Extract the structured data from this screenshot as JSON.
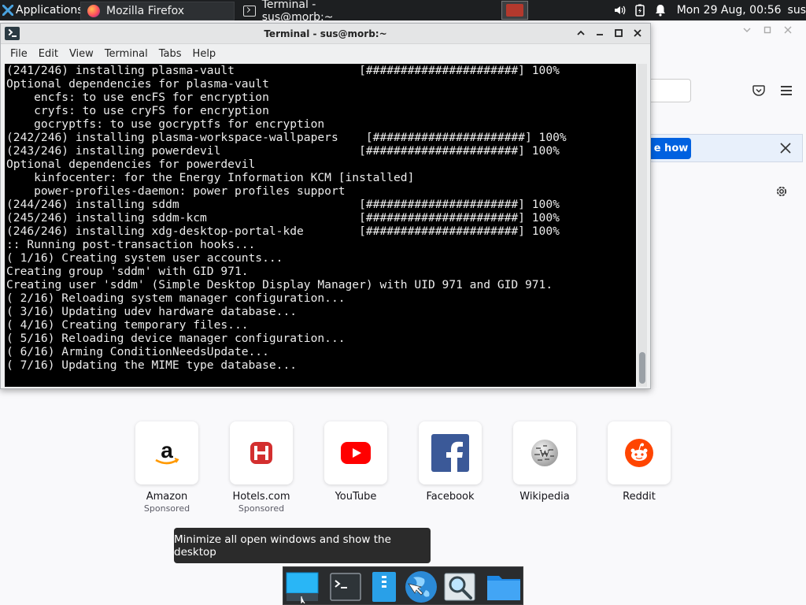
{
  "top_panel": {
    "applications_label": "Applications",
    "tasks": [
      {
        "label": "Mozilla Firefox",
        "icon": "firefox-icon"
      },
      {
        "label": "Terminal - sus@morb:~",
        "icon": "terminal-icon"
      }
    ],
    "clock": "Mon 29 Aug, 00:56",
    "user": "sus"
  },
  "terminal": {
    "title": "Terminal - sus@morb:~",
    "menu": [
      "File",
      "Edit",
      "View",
      "Terminal",
      "Tabs",
      "Help"
    ],
    "lines": [
      "(241/246) installing plasma-vault                  [######################] 100%",
      "Optional dependencies for plasma-vault",
      "    encfs: to use encFS for encryption",
      "    cryfs: to use cryFS for encryption",
      "    gocryptfs: to use gocryptfs for encryption",
      "(242/246) installing plasma-workspace-wallpapers    [######################] 100%",
      "(243/246) installing powerdevil                    [######################] 100%",
      "Optional dependencies for powerdevil",
      "    kinfocenter: for the Energy Information KCM [installed]",
      "    power-profiles-daemon: power profiles support",
      "(244/246) installing sddm                          [######################] 100%",
      "(245/246) installing sddm-kcm                      [######################] 100%",
      "(246/246) installing xdg-desktop-portal-kde        [######################] 100%",
      ":: Running post-transaction hooks...",
      "( 1/16) Creating system user accounts...",
      "Creating group 'sddm' with GID 971.",
      "Creating user 'sddm' (Simple Desktop Display Manager) with UID 971 and GID 971.",
      "( 2/16) Reloading system manager configuration...",
      "( 3/16) Updating udev hardware database...",
      "( 4/16) Creating temporary files...",
      "( 5/16) Reloading device manager configuration...",
      "( 6/16) Arming ConditionNeedsUpdate...",
      "( 7/16) Updating the MIME type database..."
    ]
  },
  "firefox": {
    "notification_button": "e how",
    "shortcuts": [
      {
        "label": "Amazon",
        "sub": "Sponsored",
        "icon": "amazon-icon"
      },
      {
        "label": "Hotels.com",
        "sub": "Sponsored",
        "icon": "hotels-icon"
      },
      {
        "label": "YouTube",
        "sub": "",
        "icon": "youtube-icon"
      },
      {
        "label": "Facebook",
        "sub": "",
        "icon": "facebook-icon"
      },
      {
        "label": "Wikipedia",
        "sub": "",
        "icon": "wikipedia-icon"
      },
      {
        "label": "Reddit",
        "sub": "",
        "icon": "reddit-icon"
      }
    ]
  },
  "tooltip": "Minimize all open windows and show the desktop",
  "dock": [
    {
      "name": "show-desktop",
      "icon": "show-desktop-icon"
    },
    {
      "name": "terminal",
      "icon": "terminal-icon"
    },
    {
      "name": "file-manager",
      "icon": "file-manager-icon"
    },
    {
      "name": "web-browser",
      "icon": "web-browser-icon"
    },
    {
      "name": "app-finder",
      "icon": "search-icon"
    },
    {
      "name": "files-folder",
      "icon": "folder-icon"
    }
  ],
  "colors": {
    "panel": "#1d1f21",
    "terminal_bg": "#000000",
    "firefox_accent": "#0061e0",
    "youtube_red": "#ff0000",
    "facebook_blue": "#1877f2",
    "reddit_orange": "#ff4500"
  }
}
